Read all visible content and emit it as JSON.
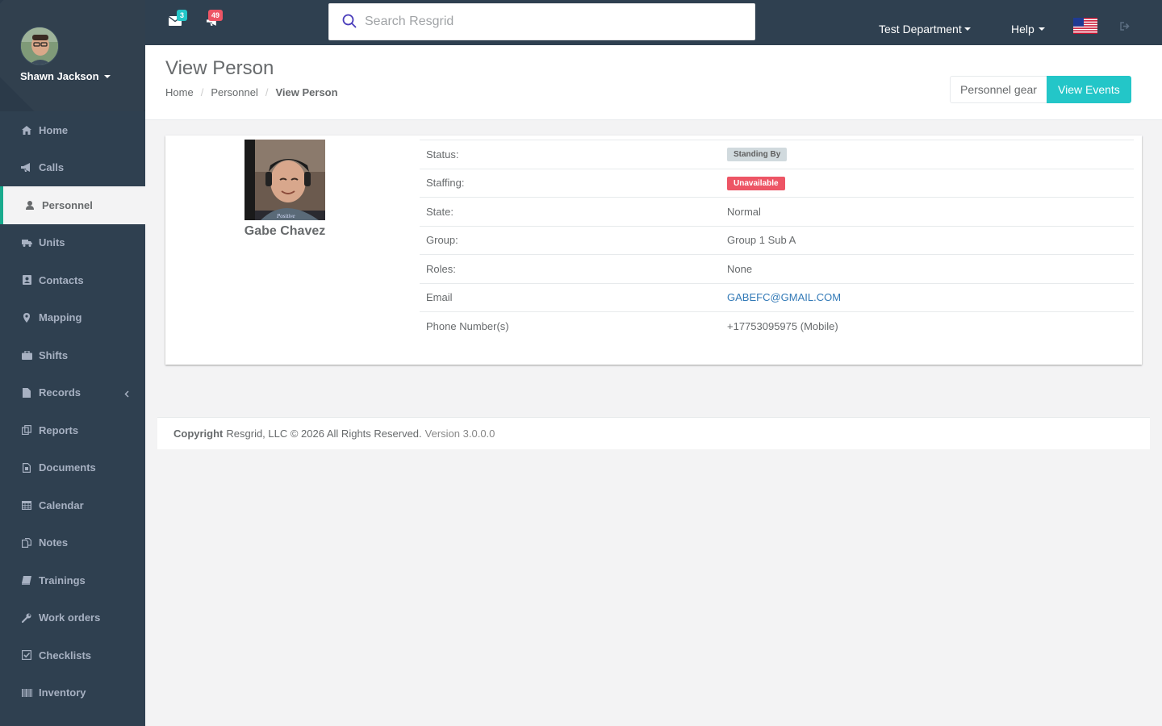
{
  "sidebar": {
    "user_name": "Shawn Jackson",
    "items": [
      {
        "label": "Home",
        "icon": "home-icon"
      },
      {
        "label": "Calls",
        "icon": "bullhorn-icon"
      },
      {
        "label": "Personnel",
        "icon": "user-icon"
      },
      {
        "label": "Units",
        "icon": "truck-icon"
      },
      {
        "label": "Contacts",
        "icon": "address-book-icon"
      },
      {
        "label": "Mapping",
        "icon": "map-marker-icon"
      },
      {
        "label": "Shifts",
        "icon": "briefcase-icon"
      },
      {
        "label": "Records",
        "icon": "file-icon"
      },
      {
        "label": "Reports",
        "icon": "copy-icon"
      },
      {
        "label": "Documents",
        "icon": "file-text-icon"
      },
      {
        "label": "Calendar",
        "icon": "calendar-icon"
      },
      {
        "label": "Notes",
        "icon": "files-icon"
      },
      {
        "label": "Trainings",
        "icon": "book-icon"
      },
      {
        "label": "Work orders",
        "icon": "wrench-icon"
      },
      {
        "label": "Checklists",
        "icon": "check-square-icon"
      },
      {
        "label": "Inventory",
        "icon": "barcode-icon"
      }
    ],
    "active": "Personnel"
  },
  "topbar": {
    "messages_count": "3",
    "calls_count": "49",
    "search_placeholder": "Search Resgrid",
    "department": "Test Department",
    "help": "Help"
  },
  "heading": {
    "title": "View Person",
    "breadcrumb": [
      "Home",
      "Personnel",
      "View Person"
    ],
    "btn_gear": "Personnel gear",
    "btn_events": "View Events"
  },
  "person": {
    "name": "Gabe Chavez",
    "rows": [
      {
        "label": "Status:",
        "value": "Standing By"
      },
      {
        "label": "Staffing:",
        "value": "Unavailable"
      },
      {
        "label": "State:",
        "value": "Normal"
      },
      {
        "label": "Group:",
        "value": "Group 1 Sub A"
      },
      {
        "label": "Roles:",
        "value": "None"
      },
      {
        "label": "Email",
        "value": "GABEFC@GMAIL.COM"
      },
      {
        "label": "Phone Number(s)",
        "value": "+17753095975 (Mobile)"
      }
    ]
  },
  "footer": {
    "copyright_bold": "Copyright",
    "copyright_text": "Resgrid, LLC © 2026 All Rights Reserved.",
    "version": "Version 3.0.0.0"
  },
  "colors": {
    "sidebar_bg": "#2f4050",
    "accent_teal": "#23c6c8",
    "danger": "#ed5565",
    "badge_messages": "#23c6c8",
    "badge_calls": "#ed5565"
  }
}
